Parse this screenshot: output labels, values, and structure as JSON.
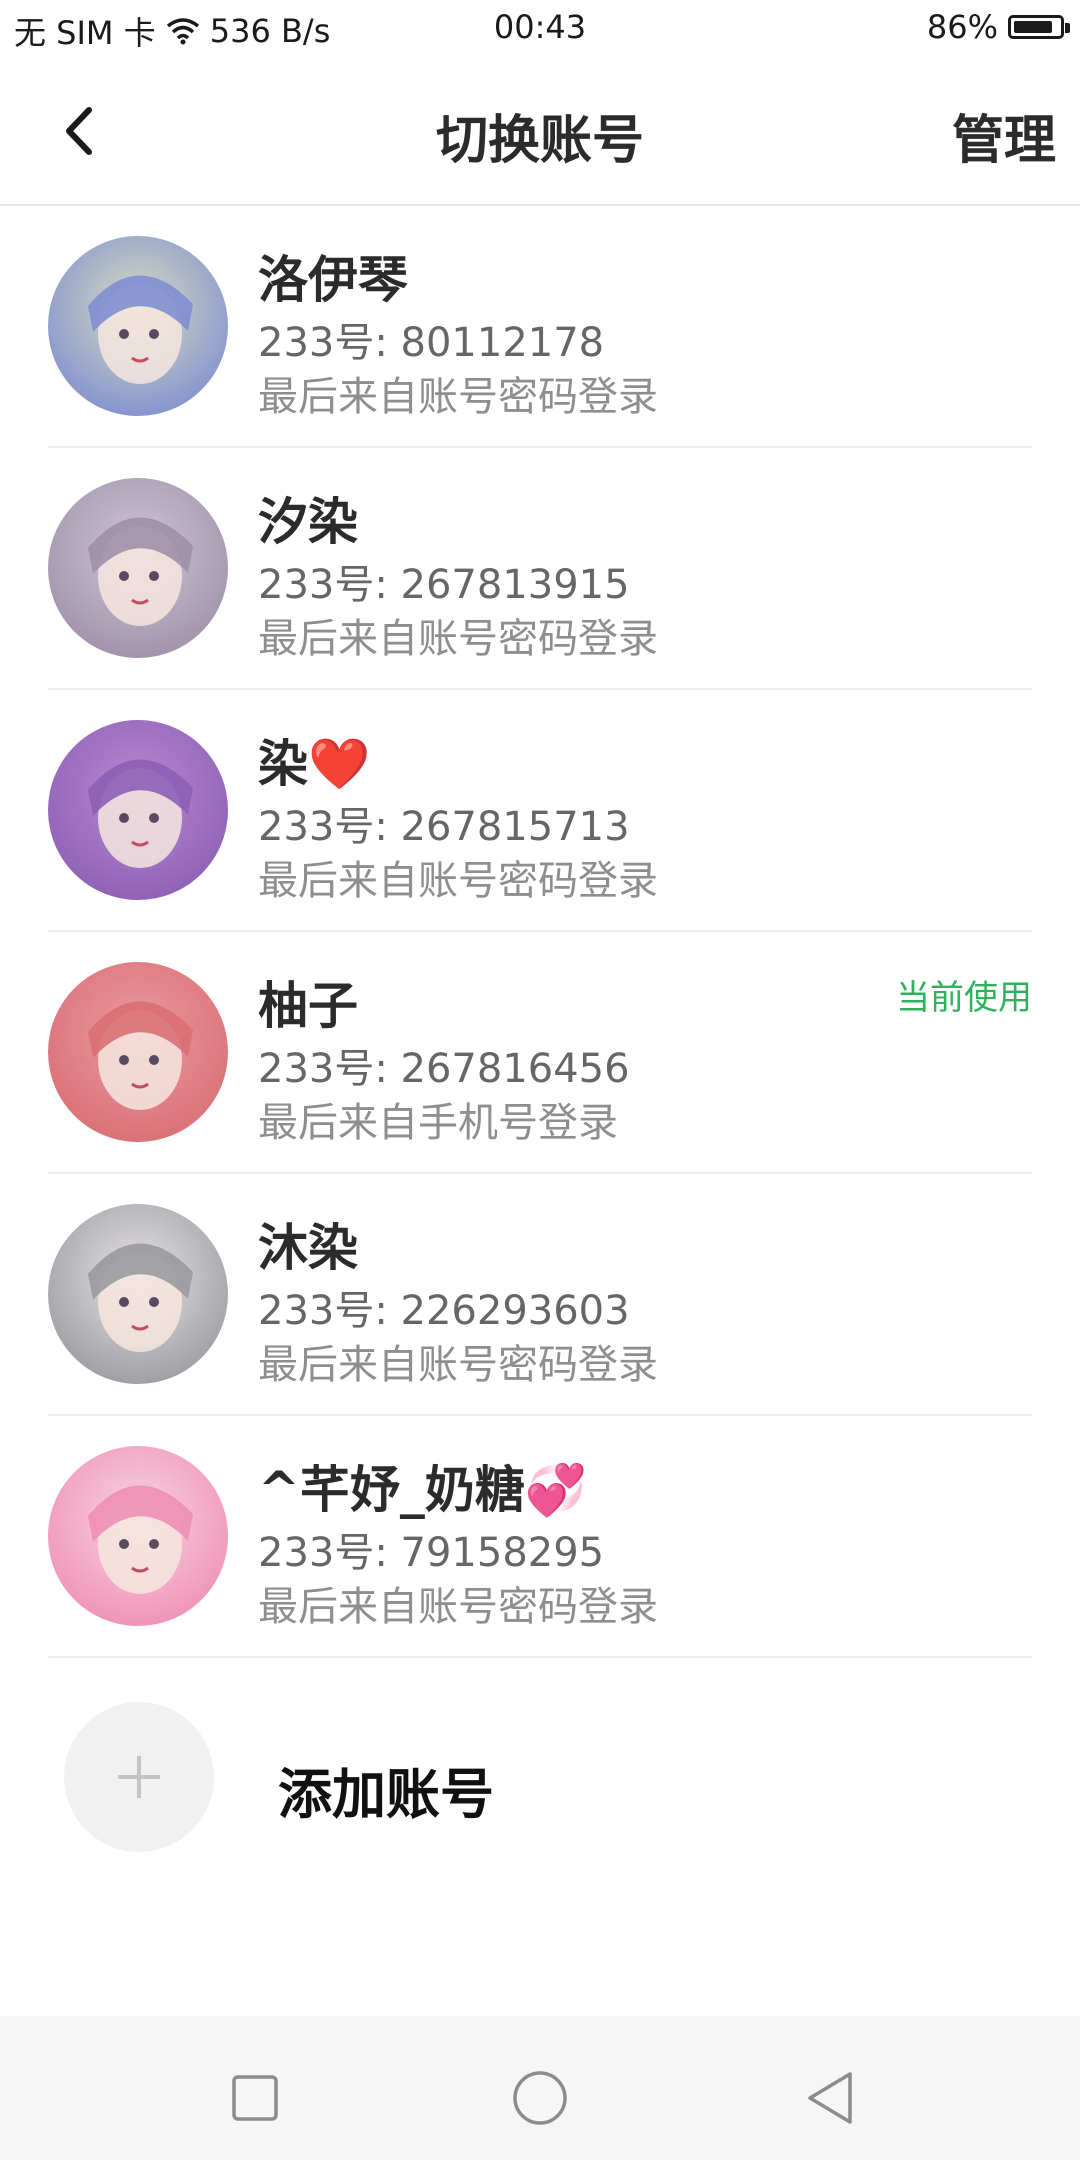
{
  "status_bar": {
    "carrier": "无 SIM 卡",
    "speed": "536 B/s",
    "time": "00:43",
    "battery": "86%",
    "battery_level": 0.86,
    "icons": [
      "wifi-icon",
      "battery-icon"
    ]
  },
  "header": {
    "title": "切换账号",
    "manage_label": "管理",
    "back_icon": "chevron-left-icon"
  },
  "accounts": [
    {
      "name": "洛伊琴",
      "id_text": "233号: 80112178",
      "login_text": "最后来自账号密码登录",
      "current": "",
      "avatar_colors": [
        "#d9dcc0",
        "#7f8fd0"
      ]
    },
    {
      "name": "汐染",
      "id_text": "233号: 267813915",
      "login_text": "最后来自账号密码登录",
      "current": "",
      "avatar_colors": [
        "#cfc7d6",
        "#9e90a8"
      ]
    },
    {
      "name": "染❤️",
      "id_text": "233号: 267815713",
      "login_text": "最后来自账号密码登录",
      "current": "",
      "avatar_colors": [
        "#b68ad1",
        "#8d5fb5"
      ]
    },
    {
      "name": "柚子",
      "id_text": "233号: 267816456",
      "login_text": "最后来自手机号登录",
      "current": "当前使用",
      "avatar_colors": [
        "#e99aa0",
        "#d96f74"
      ]
    },
    {
      "name": "沐染",
      "id_text": "233号: 226293603",
      "login_text": "最后来自账号密码登录",
      "current": "",
      "avatar_colors": [
        "#e6e3e4",
        "#9a9a9f"
      ]
    },
    {
      "name": "^芊妤_奶糖💞",
      "id_text": "233号: 79158295",
      "login_text": "最后来自账号密码登录",
      "current": "",
      "avatar_colors": [
        "#f7d5e2",
        "#ef8fb5"
      ]
    }
  ],
  "add_account": {
    "label": "添加账号",
    "icon": "plus-icon"
  },
  "nav_bar": {
    "icons": [
      "recent-apps-icon",
      "home-icon",
      "back-triangle-icon"
    ]
  }
}
